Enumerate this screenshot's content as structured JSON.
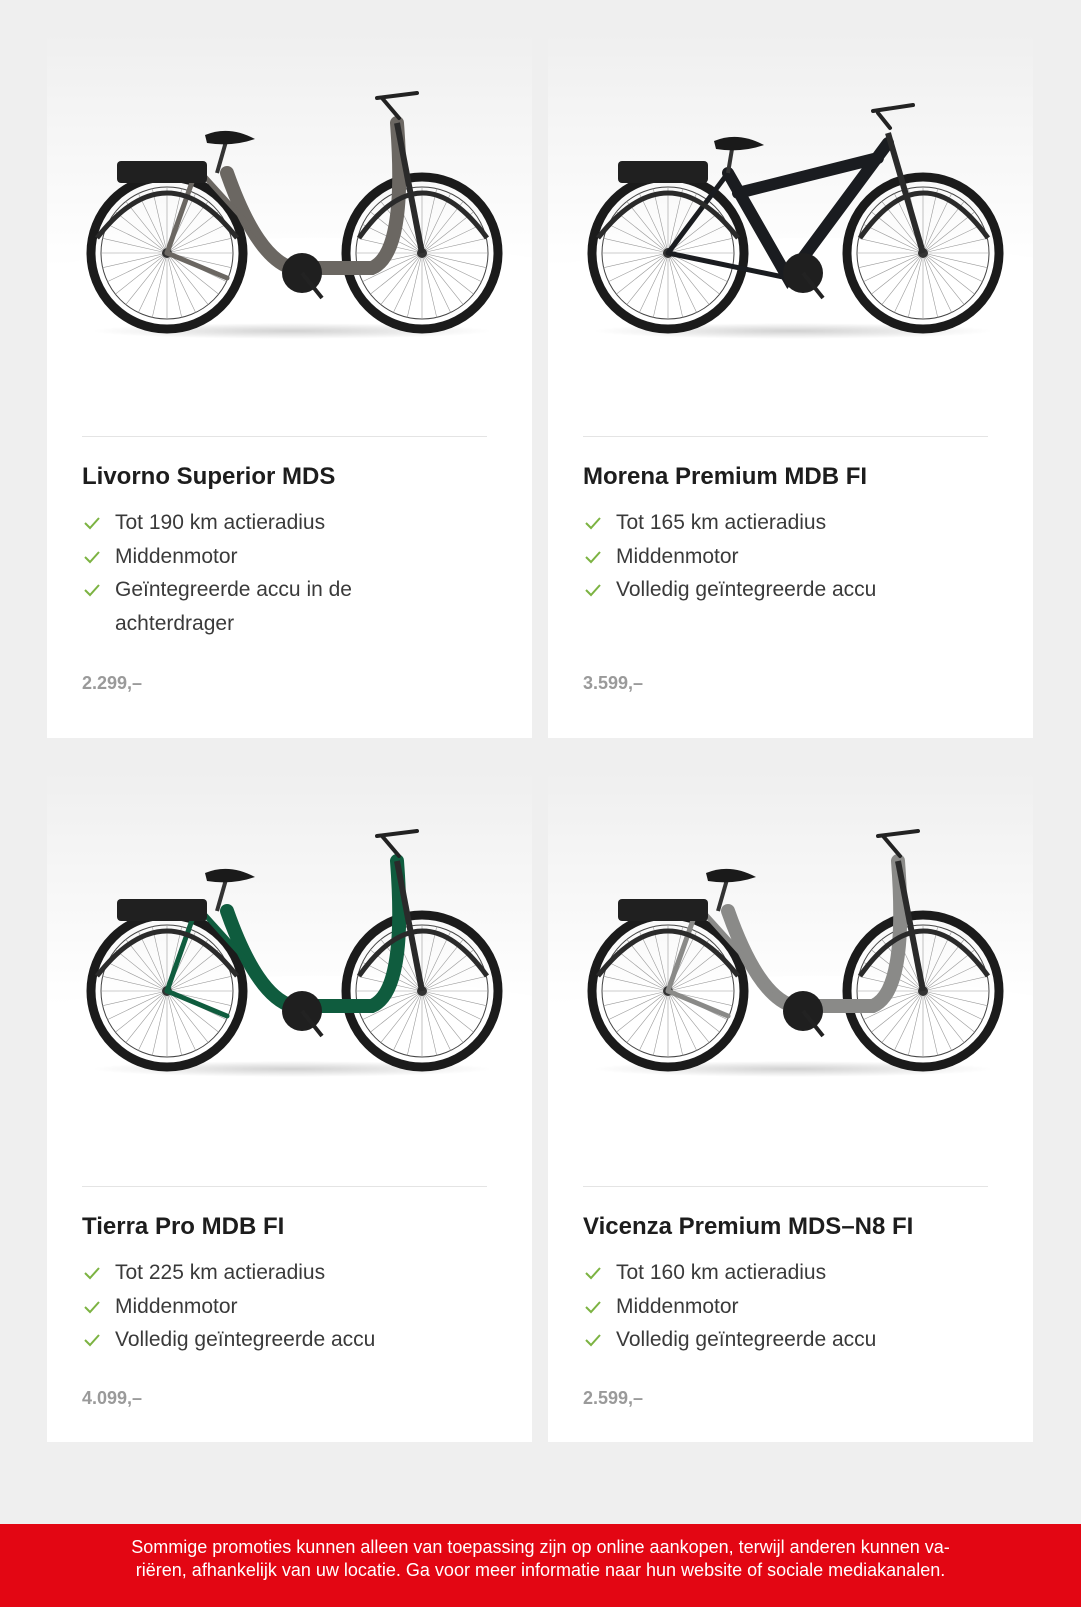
{
  "products": [
    {
      "name": "Livorno Superior MDS",
      "features": [
        "Tot 190 km actieradius",
        "Middenmotor",
        "Geïntegreerde accu in de achterdrager"
      ],
      "price": "2.299,–",
      "frame_color": "#6b6762"
    },
    {
      "name": "Morena Premium MDB FI",
      "features": [
        "Tot 165 km actieradius",
        "Middenmotor",
        "Volledig geïntegreerde accu"
      ],
      "price": "3.599,–",
      "frame_color": "#1a1c20"
    },
    {
      "name": "Tierra Pro MDB FI",
      "features": [
        "Tot 225 km actieradius",
        "Middenmotor",
        "Volledig geïntegreerde accu"
      ],
      "price": "4.099,–",
      "frame_color": "#0f5c3e"
    },
    {
      "name": "Vicenza Premium MDS–N8 FI",
      "features": [
        "Tot 160 km actieradius",
        "Middenmotor",
        "Volledig geïntegreerde accu"
      ],
      "price": "2.599,–",
      "frame_color": "#8a8a88"
    }
  ],
  "footer": {
    "line1": "Sommige promoties kunnen alleen van toepassing zijn op online aankopen, terwijl anderen kunnen va-",
    "line2": "riëren, afhankelijk van uw locatie. Ga voor meer informatie naar hun website of sociale mediakanalen."
  },
  "colors": {
    "check": "#7cb342",
    "footer_bg": "#e30613",
    "price": "#9a9a9a"
  },
  "icons": {
    "feature": "check-icon"
  }
}
